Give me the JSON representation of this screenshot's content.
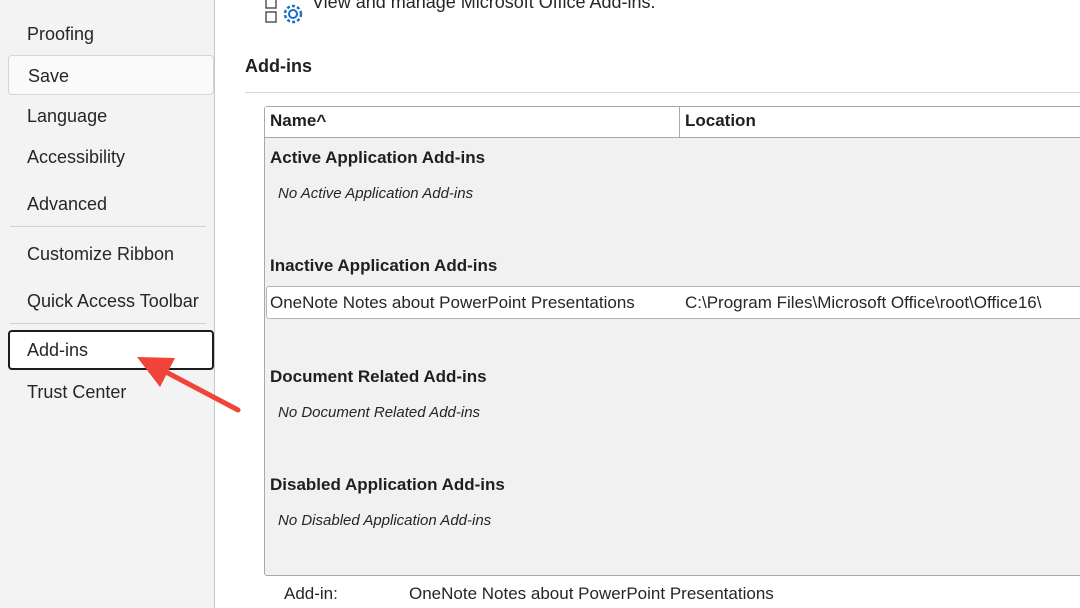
{
  "sidebar": {
    "items": [
      {
        "label": "Proofing"
      },
      {
        "label": "Save"
      },
      {
        "label": "Language"
      },
      {
        "label": "Accessibility"
      },
      {
        "label": "Advanced"
      },
      {
        "label": "Customize Ribbon"
      },
      {
        "label": "Quick Access Toolbar"
      },
      {
        "label": "Add-ins"
      },
      {
        "label": "Trust Center"
      }
    ],
    "selected": "Add-ins"
  },
  "header": {
    "icon": "add-ins-gear-icon",
    "text": "View and manage Microsoft Office Add-ins."
  },
  "section": {
    "title": "Add-ins"
  },
  "table": {
    "columns": {
      "name": "Name",
      "sort_indicator": "^",
      "location": "Location"
    },
    "groups": [
      {
        "title": "Active Application Add-ins",
        "empty_text": "No Active Application Add-ins"
      },
      {
        "title": "Inactive Application Add-ins",
        "rows": [
          {
            "name": "OneNote Notes about PowerPoint Presentations",
            "location": "C:\\Program Files\\Microsoft Office\\root\\Office16\\"
          }
        ]
      },
      {
        "title": "Document Related Add-ins",
        "empty_text": "No Document Related Add-ins"
      },
      {
        "title": "Disabled Application Add-ins",
        "empty_text": "No Disabled Application Add-ins"
      }
    ]
  },
  "details": {
    "addin_label": "Add-in:",
    "addin_value": "OneNote Notes about PowerPoint Presentations"
  },
  "annotation": {
    "arrow_color": "#f0443a",
    "target": "Add-ins"
  }
}
